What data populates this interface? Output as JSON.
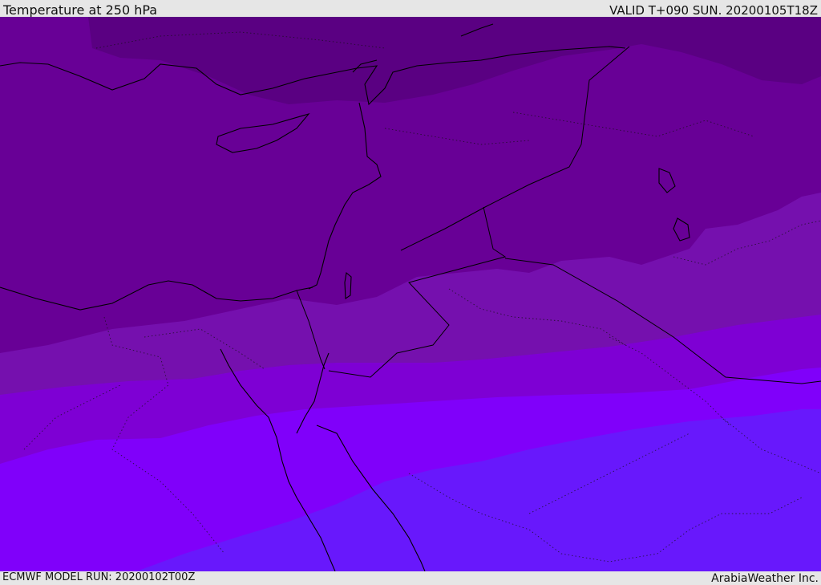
{
  "header": {
    "title": "Temperature at 250 hPa",
    "valid": "VALID T+090 SUN. 20200105T18Z"
  },
  "footer": {
    "model_run": "ECMWF MODEL RUN: 20200102T00Z",
    "credit": "ArabiaWeather Inc."
  },
  "map": {
    "colors": {
      "band1": "#5a0082",
      "band2": "#680096",
      "band3": "#7510ae",
      "band4": "#7e00d4",
      "band5": "#8000fa",
      "band6": "#6818fc",
      "coast": "#000000"
    }
  }
}
